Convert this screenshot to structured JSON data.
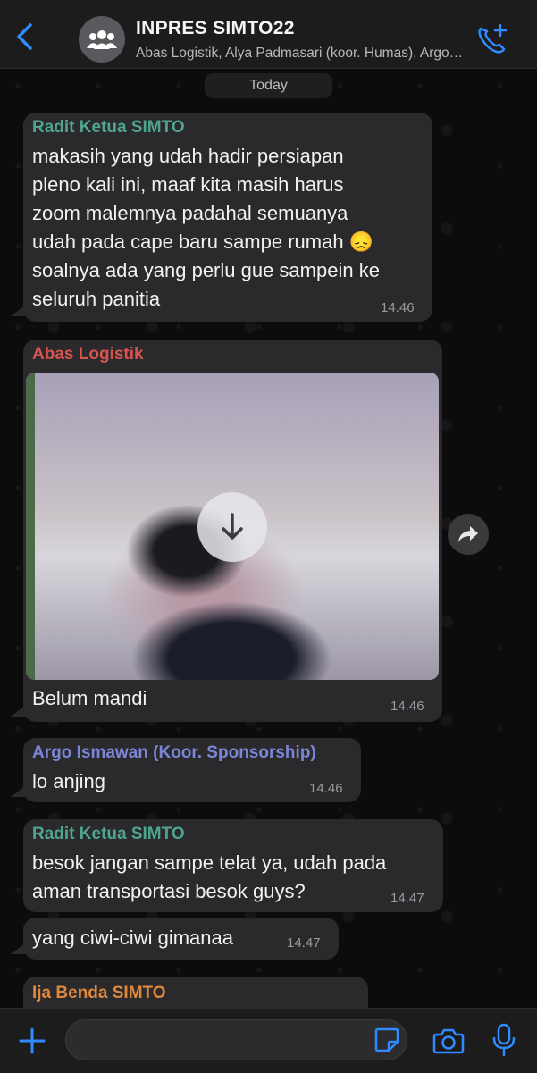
{
  "header": {
    "title": "INPRES SIMTO22",
    "subtitle": "Abas Logistik, Alya Padmasari (koor. Humas), Argo Ismawan (Koor. Sponsorship), Ija Benda SIMTO, Radit Ketua SIMTO"
  },
  "date_chip": "Today",
  "messages": [
    {
      "sender": "Radit Ketua SIMTO",
      "sender_color": "#4fa58c",
      "lines": [
        "makasih yang udah hadir persiapan",
        "pleno kali ini, maaf kita masih harus",
        "zoom malemnya padahal semuanya",
        "udah pada cape baru sampe rumah 😞",
        "soalnya ada yang perlu gue sampein ke",
        "seluruh panitia"
      ],
      "time": "14.46"
    },
    {
      "sender": "Abas Logistik",
      "sender_color": "#d9534f",
      "caption": "Belum mandi",
      "time": "14.46"
    },
    {
      "sender": "Argo Ismawan (Koor. Sponsorship)",
      "sender_color": "#7b86d6",
      "text": "lo anjing",
      "time": "14.46"
    },
    {
      "sender": "Radit Ketua SIMTO",
      "sender_color": "#4fa58c",
      "lines": [
        "besok jangan sampe telat ya, udah pada",
        "aman transportasi besok guys?"
      ],
      "time": "14.47"
    },
    {
      "text": "yang ciwi-ciwi gimanaa",
      "time": "14.47"
    },
    {
      "sender": "Ija Benda SIMTO",
      "sender_color": "#e0883a"
    }
  ],
  "input": {
    "placeholder": ""
  },
  "icons": {
    "back": "chevron-left-icon",
    "avatar": "group-icon",
    "call": "phone-add-icon",
    "download": "download-arrow-icon",
    "forward": "forward-icon",
    "plus": "plus-icon",
    "sticker": "sticker-icon",
    "camera": "camera-icon",
    "mic": "microphone-icon"
  },
  "colors": {
    "accent": "#2f8bff",
    "bubble": "#2a2a2c"
  }
}
